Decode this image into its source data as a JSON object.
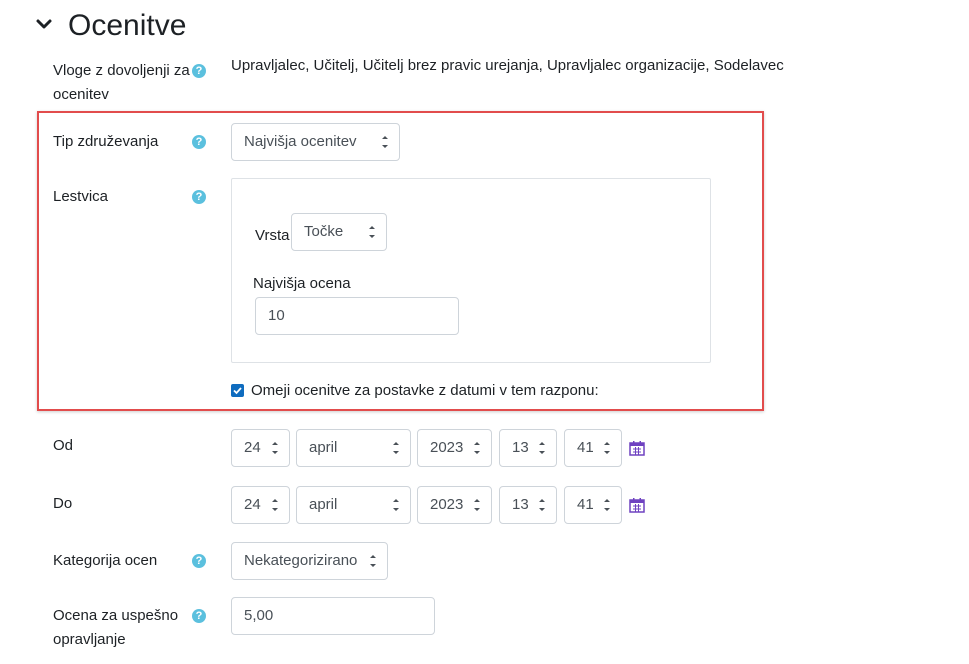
{
  "section": {
    "title": "Ocenitve"
  },
  "roles": {
    "label": "Vloge z dovoljenji za ocenitev",
    "label_line1": "Vloge z dovoljenji za",
    "label_line2": "ocenitev",
    "value": "Upravljalec, Učitelj, Učitelj brez pravic urejanja, Upravljalec organizacije, Sodelavec"
  },
  "aggregation": {
    "label": "Tip združevanja",
    "value": "Najvišja ocenitev"
  },
  "scale": {
    "label": "Lestvica",
    "type_label": "Vrsta",
    "type_value": "Točke",
    "max_label": "Najvišja ocena",
    "max_value": "10"
  },
  "limit": {
    "label": "Omeji ocenitve za postavke z datumi v tem razponu:",
    "checked": true
  },
  "from": {
    "label": "Od",
    "day": "24",
    "month": "april",
    "year": "2023",
    "hour": "13",
    "minute": "41"
  },
  "to": {
    "label": "Do",
    "day": "24",
    "month": "april",
    "year": "2023",
    "hour": "13",
    "minute": "41"
  },
  "category": {
    "label": "Kategorija ocen",
    "value": "Nekategorizirano"
  },
  "pass": {
    "label_line1": "Ocena za uspešno",
    "label_line2": "opravljanje",
    "value": "5,00"
  },
  "icons": {
    "help": "help-icon",
    "calendar": "calendar-icon",
    "collapse": "chevron-down-icon"
  },
  "colors": {
    "accent": "#0f6cbf",
    "help": "#5bc0de",
    "highlight": "#e24c4c",
    "calendar": "#6f42c1"
  }
}
